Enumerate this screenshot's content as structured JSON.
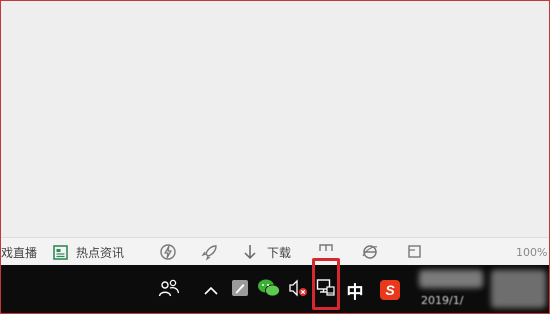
{
  "browser_statusbar": {
    "items": [
      {
        "label": "戏直播"
      },
      {
        "label": "热点资讯"
      },
      {
        "label": "下载"
      }
    ],
    "zoom": "100%"
  },
  "taskbar": {
    "ime_label": "中",
    "sogou_label": "S",
    "clock_partial": "2019/1/"
  },
  "colors": {
    "highlight": "#d7282f",
    "taskbar": "#0c0c0c",
    "sogou": "#e8391b",
    "wechat": "#3cb034"
  }
}
